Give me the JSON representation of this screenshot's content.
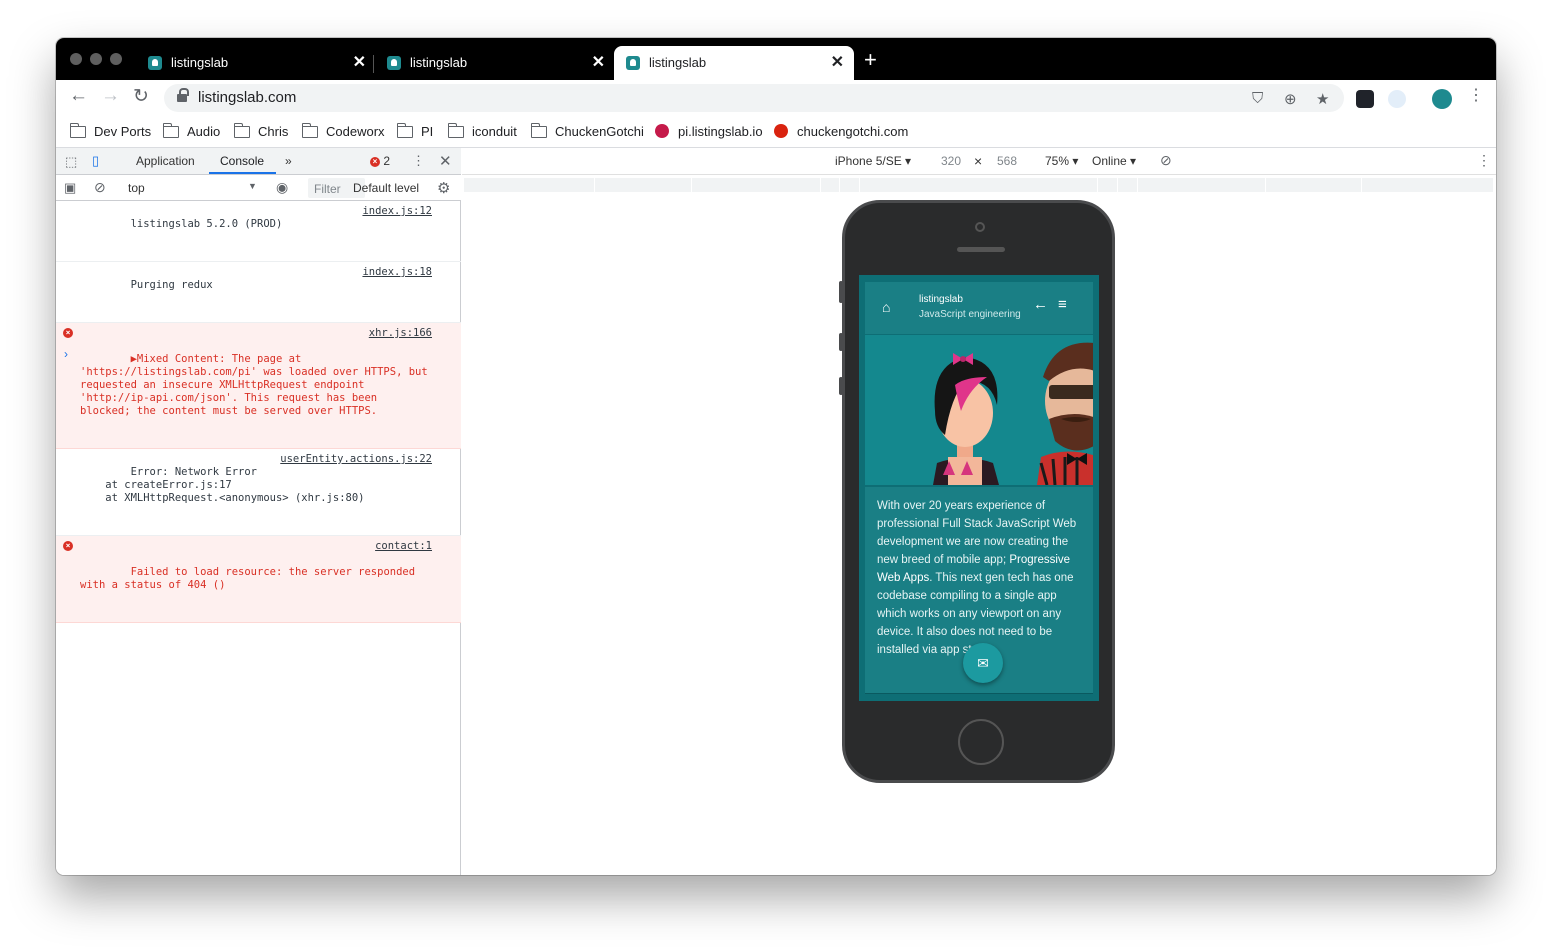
{
  "browser": {
    "tabs": [
      {
        "title": "listingslab",
        "close": "✕"
      },
      {
        "title": "listingslab",
        "close": "✕"
      },
      {
        "title": "listingslab",
        "close": "✕"
      }
    ],
    "new_tab": "+",
    "url": "listingslab.com"
  },
  "bookmarks": [
    {
      "label": "Dev Ports",
      "icon": "folder-icon"
    },
    {
      "label": "Audio",
      "icon": "folder-icon"
    },
    {
      "label": "Chris",
      "icon": "folder-icon"
    },
    {
      "label": "Codeworx",
      "icon": "folder-icon"
    },
    {
      "label": "PI",
      "icon": "folder-icon"
    },
    {
      "label": "iconduit",
      "icon": "folder-icon"
    },
    {
      "label": "ChuckenGotchi",
      "icon": "folder-icon"
    },
    {
      "label": "pi.listingslab.io",
      "icon": "raspberry-icon"
    },
    {
      "label": "chuckengotchi.com",
      "icon": "chicken-icon"
    }
  ],
  "devtools": {
    "tabs": [
      "Application",
      "Console"
    ],
    "active_tab": "Console",
    "more": "»",
    "error_count": "2",
    "context": "top",
    "filter_placeholder": "Filter",
    "level": "Default level",
    "messages": [
      {
        "type": "log",
        "text": "listingslab 5.2.0 (PROD)",
        "source": "index.js:12"
      },
      {
        "type": "log",
        "text": "Purging redux",
        "source": "index.js:18"
      },
      {
        "type": "error",
        "text": "▶Mixed Content: The page at 'https://listingslab.com/pi' was loaded over HTTPS, but requested an insecure XMLHttpRequest endpoint 'http://ip-api.com/json'. This request has been blocked; the content must be served over HTTPS.",
        "source": "xhr.js:166"
      },
      {
        "type": "log",
        "text": "Error: Network Error\n    at createError.js:17\n    at XMLHttpRequest.<anonymous> (xhr.js:80)",
        "source": "userEntity.actions.js:22"
      },
      {
        "type": "error",
        "text": "Failed to load resource: the server responded with a status of 404 ()",
        "source": "contact:1"
      }
    ],
    "prompt": "›"
  },
  "device_toolbar": {
    "device": "iPhone 5/SE ▾",
    "width": "320",
    "times": "×",
    "height": "568",
    "zoom": "75% ▾",
    "network": "Online ▾"
  },
  "app": {
    "title": "listingslab",
    "subtitle": "JavaScript engineering",
    "body_before": "With over 20 years experience of professional Full Stack JavaScript Web development we are now creating the new breed of mobile app; ",
    "body_link": "Progressive Web Apps",
    "body_after": ". This next gen tech has one codebase compiling to a single app which works on any viewport on any device. It also does not need to be installed via app stores."
  },
  "colors": {
    "app_teal": "#1a7f85",
    "hero_teal": "#14888e",
    "error_red": "#d93025",
    "devtools_blue": "#1a73e8"
  }
}
